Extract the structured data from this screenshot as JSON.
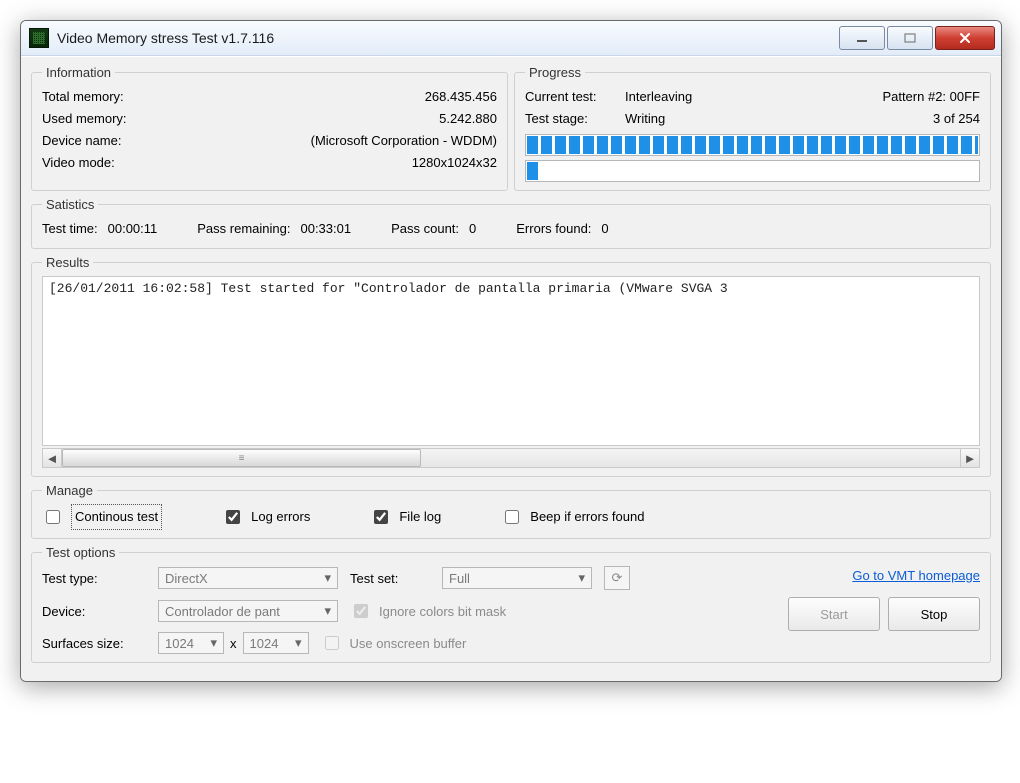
{
  "window": {
    "title": "Video Memory stress Test v1.7.116"
  },
  "information": {
    "legend": "Information",
    "total_memory_label": "Total memory:",
    "total_memory_value": "268.435.456",
    "used_memory_label": "Used memory:",
    "used_memory_value": "5.242.880",
    "device_name_label": "Device name:",
    "device_name_value": "(Microsoft Corporation - WDDM)",
    "video_mode_label": "Video mode:",
    "video_mode_value": "1280x1024x32"
  },
  "progress": {
    "legend": "Progress",
    "current_test_label": "Current test:",
    "current_test_value": "Interleaving",
    "pattern_label": "Pattern #2: 00FF",
    "test_stage_label": "Test stage:",
    "test_stage_value": "Writing",
    "stage_count": "3 of 254",
    "bar1_percent": 100,
    "bar2_percent": 3
  },
  "statistics": {
    "legend": "Satistics",
    "test_time_label": "Test time:",
    "test_time_value": "00:00:11",
    "pass_remaining_label": "Pass remaining:",
    "pass_remaining_value": "00:33:01",
    "pass_count_label": "Pass count:",
    "pass_count_value": "0",
    "errors_found_label": "Errors found:",
    "errors_found_value": "0"
  },
  "results": {
    "legend": "Results",
    "log_line": "[26/01/2011 16:02:58] Test started for \"Controlador de pantalla primaria (VMware SVGA 3"
  },
  "manage": {
    "legend": "Manage",
    "continuous_test": "Continous test",
    "log_errors": "Log errors",
    "file_log": "File log",
    "beep": "Beep if errors found"
  },
  "options": {
    "legend": "Test options",
    "test_type_label": "Test type:",
    "test_type_value": "DirectX",
    "test_set_label": "Test set:",
    "test_set_value": "Full",
    "device_label": "Device:",
    "device_value": "Controlador de pant",
    "ignore_colors": "Ignore colors bit mask",
    "surfaces_label": "Surfaces size:",
    "surface_w": "1024",
    "surface_h": "1024",
    "size_x": "x",
    "use_onscreen": "Use onscreen buffer",
    "homepage_link": "Go to VMT homepage",
    "start_label": "Start",
    "stop_label": "Stop"
  }
}
